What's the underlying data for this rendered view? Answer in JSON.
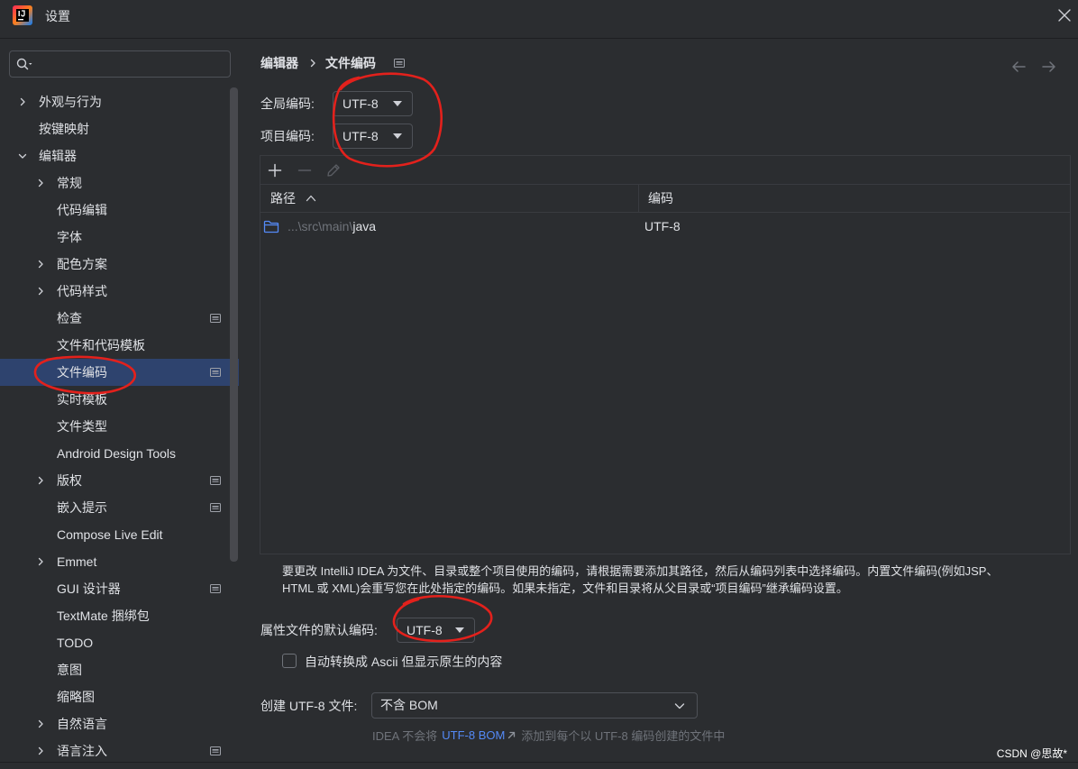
{
  "window": {
    "title": "设置"
  },
  "icons": {
    "app": "intellij-idea-logo-icon",
    "close": "close-icon",
    "search": "search-icon",
    "back": "arrow-left-icon",
    "forward": "arrow-right-icon",
    "breadcrumb_separator": "chevron-right-icon",
    "breadcrumb_scope": "project-scope-icon"
  },
  "colors": {
    "background": "#2b2d30",
    "text": "#dfe1e5",
    "muted": "#6f737a",
    "border": "#43454a",
    "selection": "#2e436e",
    "link": "#548af7",
    "annotation": "#e3211c"
  },
  "search": {
    "value": ""
  },
  "sidebar": {
    "items": [
      {
        "label": "外观与行为",
        "chevron_icon": "chevron-right-icon"
      },
      {
        "label": "按键映射"
      },
      {
        "label": "编辑器",
        "chevron_icon": "chevron-down-icon"
      },
      {
        "label": "常规",
        "chevron_icon": "chevron-right-icon"
      },
      {
        "label": "代码编辑"
      },
      {
        "label": "字体"
      },
      {
        "label": "配色方案",
        "chevron_icon": "chevron-right-icon"
      },
      {
        "label": "代码样式",
        "chevron_icon": "chevron-right-icon"
      },
      {
        "label": "检查",
        "scope_icon": "project-scope-icon"
      },
      {
        "label": "文件和代码模板"
      },
      {
        "label": "文件编码",
        "scope_icon": "project-scope-icon",
        "selected": true
      },
      {
        "label": "实时模板"
      },
      {
        "label": "文件类型"
      },
      {
        "label": "Android Design Tools"
      },
      {
        "label": "版权",
        "chevron_icon": "chevron-right-icon",
        "scope_icon": "project-scope-icon"
      },
      {
        "label": "嵌入提示",
        "scope_icon": "project-scope-icon"
      },
      {
        "label": "Compose Live Edit"
      },
      {
        "label": "Emmet",
        "chevron_icon": "chevron-right-icon"
      },
      {
        "label": "GUI 设计器",
        "scope_icon": "project-scope-icon"
      },
      {
        "label": "TextMate 捆绑包"
      },
      {
        "label": "TODO"
      },
      {
        "label": "意图"
      },
      {
        "label": "缩略图"
      },
      {
        "label": "自然语言",
        "chevron_icon": "chevron-right-icon"
      },
      {
        "label": "语言注入",
        "chevron_icon": "chevron-right-icon",
        "scope_icon": "project-scope-icon"
      }
    ]
  },
  "breadcrumb": {
    "parent": "编辑器",
    "current": "文件编码"
  },
  "encodings": {
    "global": {
      "label": "全局编码:",
      "value": "UTF-8"
    },
    "project": {
      "label": "项目编码:",
      "value": "UTF-8"
    }
  },
  "table": {
    "toolbar": {
      "add_icon": "plus-icon",
      "remove_icon": "minus-icon",
      "edit_icon": "pencil-icon"
    },
    "columns": {
      "path": "路径",
      "encoding": "编码"
    },
    "sort_icon": "chevron-up-icon",
    "rows": [
      {
        "icon": "folder-icon",
        "path_prefix": "...\\src\\main\\",
        "path_name": "java",
        "encoding": "UTF-8"
      }
    ]
  },
  "info": {
    "lines": [
      "要更改 IntelliJ IDEA 为文件、目录或整个项目使用的编码，请根据需要添加其路径，然后从编码列表中选择编码。内置文件编码(例如JSP、",
      "HTML 或 XML)会重写您在此处指定的编码。如果未指定，文件和目录将从父目录或“项目编码”继承编码设置。"
    ]
  },
  "properties": {
    "label": "属性文件的默认编码:",
    "value": "UTF-8"
  },
  "ascii_option": {
    "label": "自动转换成 Ascii 但显示原生的内容",
    "checked": false
  },
  "bom": {
    "label": "创建 UTF-8 文件:",
    "value": "不含 BOM"
  },
  "bom_hint": {
    "prefix": "IDEA 不会将",
    "link": "UTF-8 BOM",
    "link_icon": "external-link-icon",
    "suffix": "添加到每个以 UTF-8 编码创建的文件中"
  },
  "watermark": "CSDN @思故*"
}
